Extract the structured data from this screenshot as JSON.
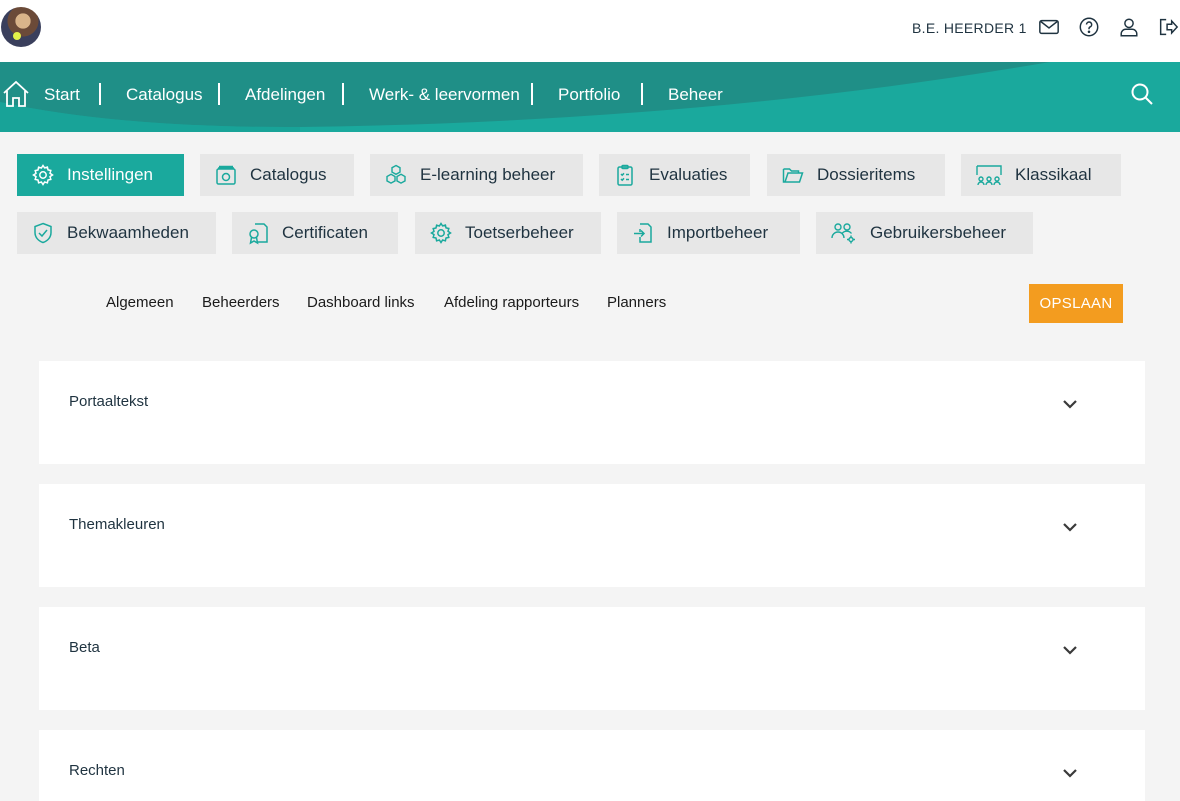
{
  "header": {
    "username": "B.E. HEERDER 1",
    "icons": [
      "mail-icon",
      "help-icon",
      "user-icon",
      "logout-icon"
    ]
  },
  "nav": {
    "items": [
      "Start",
      "Catalogus",
      "Afdelingen",
      "Werk- & leervormen",
      "Portfolio",
      "Beheer"
    ]
  },
  "admin": {
    "tiles": [
      {
        "label": "Instellingen",
        "icon": "gear-icon"
      },
      {
        "label": "Catalogus",
        "icon": "catalog-icon"
      },
      {
        "label": "E-learning beheer",
        "icon": "cubes-icon"
      },
      {
        "label": "Evaluaties",
        "icon": "clipboard-icon"
      },
      {
        "label": "Dossieritems",
        "icon": "folder-icon"
      },
      {
        "label": "Klassikaal",
        "icon": "classroom-icon"
      },
      {
        "label": "Bekwaamheden",
        "icon": "shield-check-icon"
      },
      {
        "label": "Certificaten",
        "icon": "certificate-icon"
      },
      {
        "label": "Toetserbeheer",
        "icon": "gear-icon"
      },
      {
        "label": "Importbeheer",
        "icon": "import-icon"
      },
      {
        "label": "Gebruikersbeheer",
        "icon": "users-gear-icon"
      }
    ]
  },
  "subtabs": [
    "Algemeen",
    "Beheerders",
    "Dashboard links",
    "Afdeling rapporteurs",
    "Planners"
  ],
  "save_label": "OPSLAAN",
  "panels": [
    "Portaaltekst",
    "Themakleuren",
    "Beta",
    "Rechten"
  ],
  "colors": {
    "teal": "#1aa99d",
    "nav_dark": "#1f8f87",
    "save": "#f39c1f",
    "tile_bg": "#e7e7e7"
  }
}
